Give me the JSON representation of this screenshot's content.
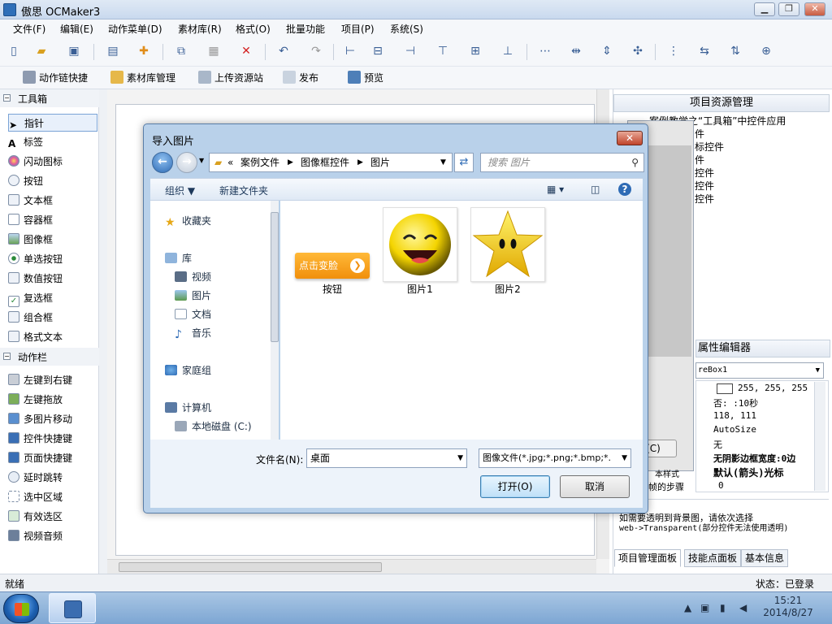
{
  "app": {
    "title": "傲思 OCMaker3"
  },
  "window_buttons": {
    "minimize": "▁",
    "maximize": "❐",
    "close": "✕"
  },
  "menu": [
    "文件(F)",
    "编辑(E)",
    "动作菜单(D)",
    "素材库(R)",
    "格式(O)",
    "批量功能",
    "项目(P)",
    "系统(S)"
  ],
  "toolbar2": [
    "动作链快捷",
    "素材库管理",
    "上传资源站",
    "发布",
    "预览"
  ],
  "toolbox": {
    "section1": "工具箱",
    "tools1": [
      "指针",
      "标签",
      "闪动图标",
      "按钮",
      "文本框",
      "容器框",
      "图像框",
      "单选按钮",
      "数值按钮",
      "复选框",
      "组合框",
      "格式文本"
    ],
    "section2": "动作栏",
    "tools2": [
      "左键到右键",
      "左键拖放",
      "多图片移动",
      "控件快捷键",
      "页面快捷键",
      "延时跳转",
      "选中区域",
      "有效选区",
      "视频音频"
    ]
  },
  "right_panel": {
    "header": "项目资源管理",
    "tree": [
      "案例教学之“工具箱”中控件应用",
      "件",
      "标控件",
      "件",
      "控件",
      "控件",
      "控件"
    ],
    "bg_button": "(C)",
    "prop_header": "属性编辑器",
    "prop_select": "reBox1",
    "props": [
      {
        "name": "",
        "value": "255, 255, 255"
      },
      {
        "name": "",
        "value": "否: :10秒"
      },
      {
        "name": "",
        "value": "118, 111"
      },
      {
        "name": "",
        "value": "AutoSize"
      },
      {
        "name": "",
        "value": "无"
      },
      {
        "name": "",
        "value": "无阴影边框宽度:0边"
      },
      {
        "name": "本样式",
        "value": "默认(箭头)光标"
      },
      {
        "name": "帧的步骤",
        "value": "0"
      }
    ],
    "desc_line1": "如需要透明到背景图，请依次选择",
    "desc_line2": "web->Transparent(部分控件无法使用透明)",
    "tabs": [
      "项目管理面板",
      "技能点面板",
      "基本信息"
    ]
  },
  "status": {
    "left": "就绪",
    "right": "状态：已登录"
  },
  "taskbar": {
    "time": "15:21",
    "date": "2014/8/27"
  },
  "dialog": {
    "title": "导入图片",
    "close": "✕",
    "path": [
      "«",
      "案例文件",
      "图像框控件",
      "图片"
    ],
    "search_placeholder": "搜索 图片",
    "organize": "组织 ▼",
    "new_folder": "新建文件夹",
    "nav": {
      "favorites": "收藏夹",
      "library": "库",
      "library_items": [
        "视频",
        "图片",
        "文档",
        "音乐"
      ],
      "homegroup": "家庭组",
      "computer": "计算机",
      "disk": "本地磁盘 (C:)"
    },
    "files": [
      {
        "name": "按钮",
        "thumb_text": "点击变脸"
      },
      {
        "name": "图片1"
      },
      {
        "name": "图片2"
      }
    ],
    "filename_label": "文件名(N):",
    "filename_value": "桌面",
    "filter": "图像文件(*.jpg;*.png;*.bmp;*.",
    "open": "打开(O)",
    "cancel": "取消"
  },
  "colors": {
    "accent": "#2e6bb5",
    "orange": "#f5a21b",
    "title_bg": "#b9d1ea"
  }
}
